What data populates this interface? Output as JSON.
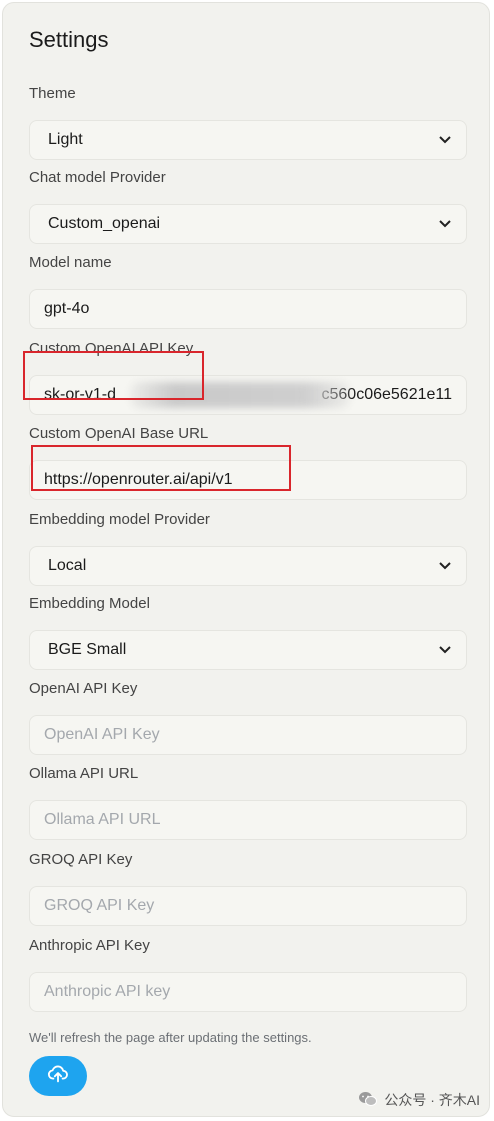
{
  "page": {
    "title": "Settings"
  },
  "fields": {
    "theme": {
      "label": "Theme",
      "value": "Light"
    },
    "chat_provider": {
      "label": "Chat model Provider",
      "value": "Custom_openai"
    },
    "model_name": {
      "label": "Model name",
      "value": "gpt-4o"
    },
    "custom_openai_key": {
      "label": "Custom OpenAI API Key",
      "value_start": "sk-or-v1-d",
      "value_end": "c560c06e5621e11"
    },
    "custom_openai_base_url": {
      "label": "Custom OpenAI Base URL",
      "value": "https://openrouter.ai/api/v1"
    },
    "embedding_provider": {
      "label": "Embedding model Provider",
      "value": "Local"
    },
    "embedding_model": {
      "label": "Embedding Model",
      "value": "BGE Small"
    },
    "openai_key": {
      "label": "OpenAI API Key",
      "placeholder": "OpenAI API Key"
    },
    "ollama_url": {
      "label": "Ollama API URL",
      "placeholder": "Ollama API URL"
    },
    "groq_key": {
      "label": "GROQ API Key",
      "placeholder": "GROQ API Key"
    },
    "anthropic_key": {
      "label": "Anthropic API Key",
      "placeholder": "Anthropic API key"
    }
  },
  "note": "We'll refresh the page after updating the settings.",
  "submit": {
    "icon": "cloud-upload-icon"
  },
  "watermark": {
    "text": "公众号 · 齐木AI",
    "icon": "wechat-icon"
  },
  "colors": {
    "accent": "#1ea4ef",
    "highlight": "#d9262c",
    "panel": "#f2f2ee"
  }
}
